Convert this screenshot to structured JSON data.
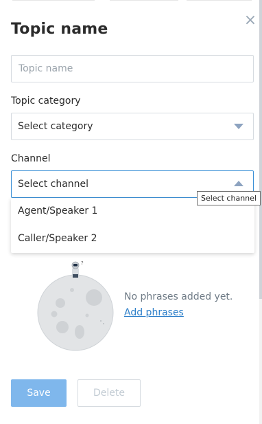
{
  "panel": {
    "title": "Topic name",
    "close_glyph": "×"
  },
  "topic_name": {
    "placeholder": "Topic name",
    "value": ""
  },
  "category": {
    "label": "Topic category",
    "selected": "Select category"
  },
  "channel": {
    "label": "Channel",
    "selected": "Select channel",
    "tooltip": "Select channel",
    "options": [
      "Agent/Speaker 1",
      "Caller/Speaker 2"
    ]
  },
  "empty_state": {
    "message": "No phrases added yet.",
    "link": "Add phrases"
  },
  "actions": {
    "save": "Save",
    "delete": "Delete"
  },
  "colors": {
    "accent": "#3a8fd6",
    "save_button": "#7fb7ec",
    "link": "#2d7fc9"
  },
  "icons": {
    "close": "close-icon",
    "dropdown_closed": "chevron-down-icon",
    "dropdown_open": "chevron-up-icon",
    "illustration": "moon-astronaut-illustration"
  }
}
